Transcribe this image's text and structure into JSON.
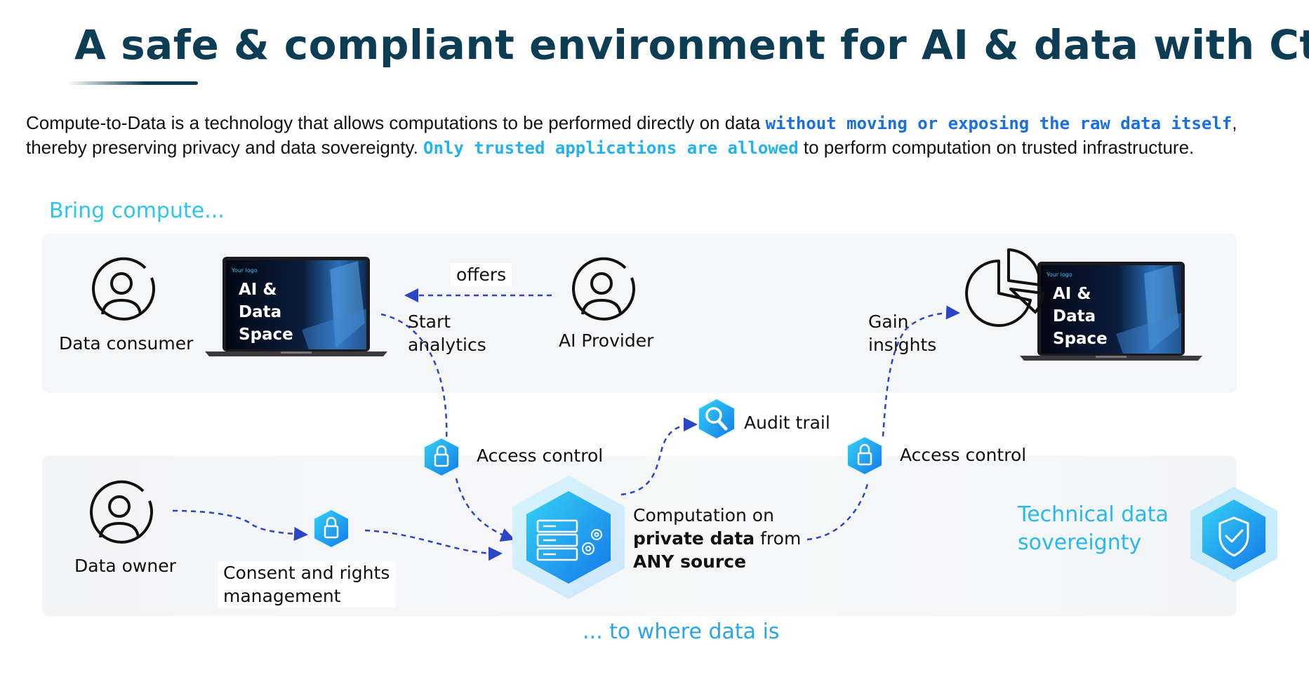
{
  "title": "A safe & compliant environment for AI & data with CtD",
  "intro": {
    "part1": "Compute-to-Data is a technology that allows computations to be performed directly on data ",
    "highlight1": "without moving or exposing the raw data itself",
    "part2": ", thereby preserving privacy and data sovereignty. ",
    "highlight2": "Only trusted applications are allowed",
    "part3": " to perform computation on trusted infrastructure."
  },
  "sections": {
    "top": "Bring compute...",
    "bottom": "... to where data is"
  },
  "actors": {
    "data_consumer": "Data consumer",
    "ai_provider": "AI Provider",
    "data_owner": "Data owner"
  },
  "laptop": {
    "logo": "Your logo",
    "line1": "AI &",
    "line2": "Data",
    "line3": "Space"
  },
  "labels": {
    "offers": "offers",
    "start_line1": "Start",
    "start_line2": "analytics",
    "gain_line1": "Gain",
    "gain_line2": "insights",
    "access_control_left": "Access control",
    "access_control_right": "Access control",
    "audit_trail": "Audit trail",
    "consent_line1": "Consent and rights",
    "consent_line2": "management",
    "computation_line1": "Computation on",
    "computation_bold1": "private data",
    "computation_line2_rest": " from",
    "computation_bold2": "ANY source"
  },
  "sovereignty": {
    "line1": "Technical data",
    "line2": "sovereignty"
  },
  "icons": {
    "actor": "person-icon",
    "lock": "lock-icon",
    "search": "search-icon",
    "server": "server-icon",
    "gear": "gear-icon",
    "pie": "pie-chart-icon",
    "shield": "shield-check-icon"
  },
  "colors": {
    "title": "#0c3d55",
    "accent_blue": "#1a6ee6",
    "accent_cyan": "#22b3ef",
    "arrow": "#2a45c8"
  }
}
